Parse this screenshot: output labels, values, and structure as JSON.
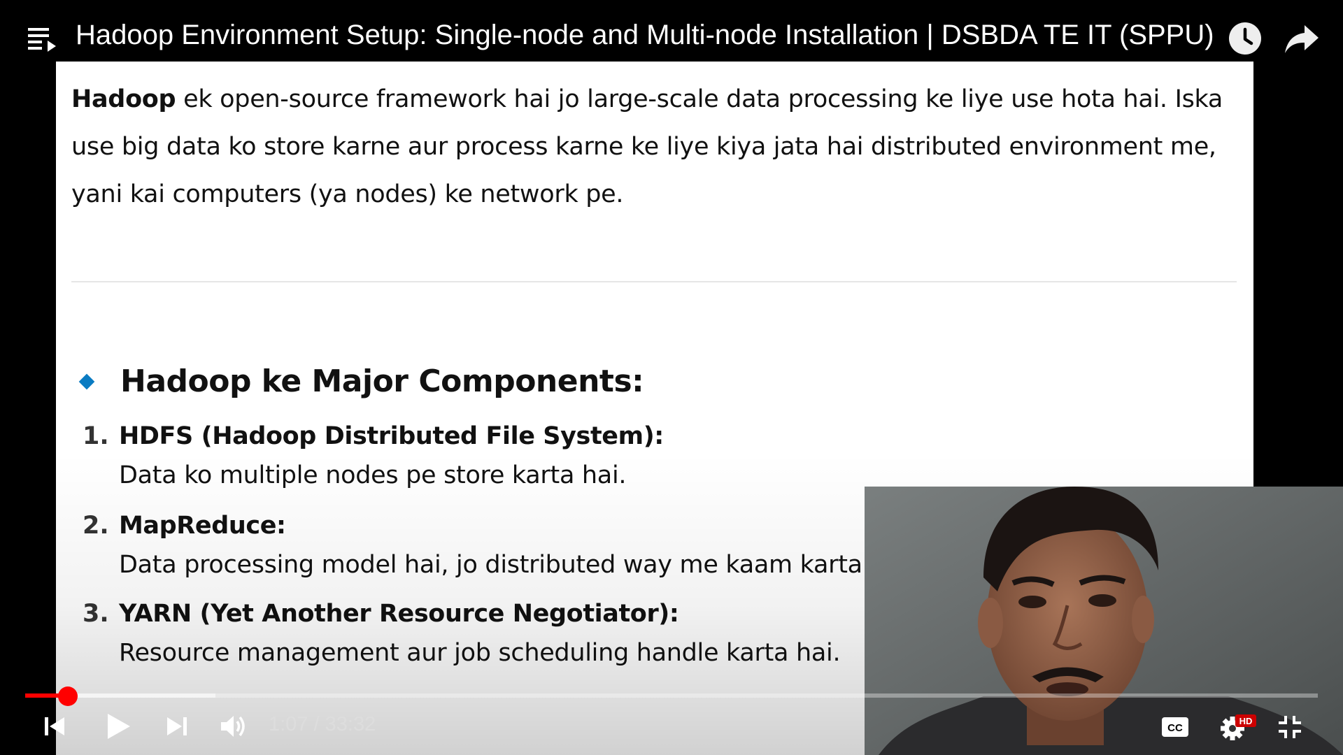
{
  "video": {
    "title": "Hadoop Environment Setup: Single-node and Multi-node Installation | DSBDA TE IT (SPPU)",
    "current_time": "1:07",
    "time_separator": " / ",
    "duration": "33:32",
    "progress_fraction": 0.033,
    "buffered_fraction": 0.147
  },
  "slide": {
    "intro_bold": "Hadoop",
    "intro_rest": " ek open-source framework hai jo large-scale data processing ke liye use hota hai. Iska use big data ko store karne aur process karne ke liye kiya jata hai distributed environment me, yani kai computers (ya nodes) ke network pe.",
    "heading": "Hadoop ke Major Components:",
    "components": [
      {
        "num": "1.",
        "title": "HDFS (Hadoop Distributed File System):",
        "desc": "Data ko multiple nodes pe store karta hai."
      },
      {
        "num": "2.",
        "title": "MapReduce:",
        "desc": "Data processing model hai, jo distributed way me kaam karta hai."
      },
      {
        "num": "3.",
        "title": "YARN (Yet Another Resource Negotiator):",
        "desc": "Resource management aur job scheduling handle karta hai."
      }
    ]
  },
  "controls": {
    "cc_label": "CC",
    "hd_badge": "HD"
  },
  "icons": [
    "playlist-icon",
    "watch-later-icon",
    "share-icon",
    "previous-icon",
    "play-icon",
    "next-icon",
    "volume-icon",
    "captions-icon",
    "settings-icon",
    "exit-fullscreen-icon"
  ],
  "colors": {
    "accent": "#ff0000",
    "bullet": "#0a7bc2",
    "hd_badge": "#cc0000"
  }
}
